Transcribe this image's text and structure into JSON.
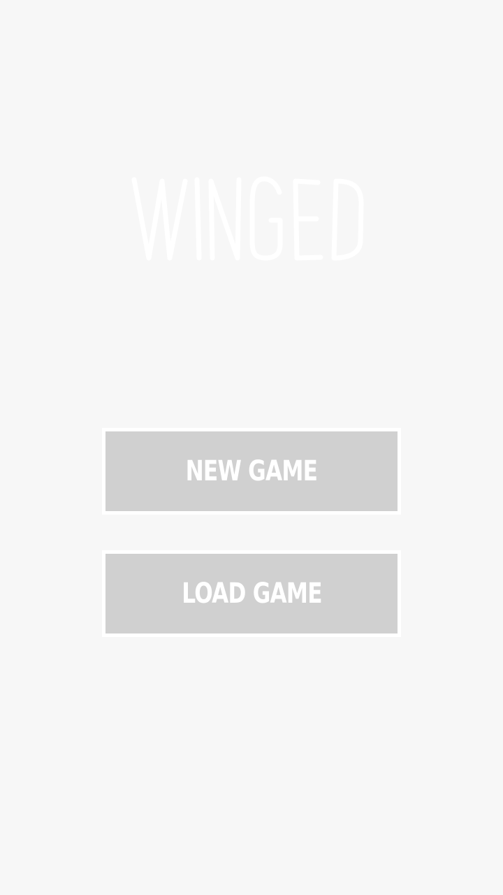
{
  "title": {
    "text": "WINGED",
    "color": "#ffffff"
  },
  "menu": {
    "new_game_label": "NEW GAME",
    "load_game_label": "LOAD GAME"
  },
  "colors": {
    "background": "#f7f7f7",
    "button_fill": "#d0d0d0",
    "button_border": "#ffffff",
    "button_text": "#ffffff"
  }
}
